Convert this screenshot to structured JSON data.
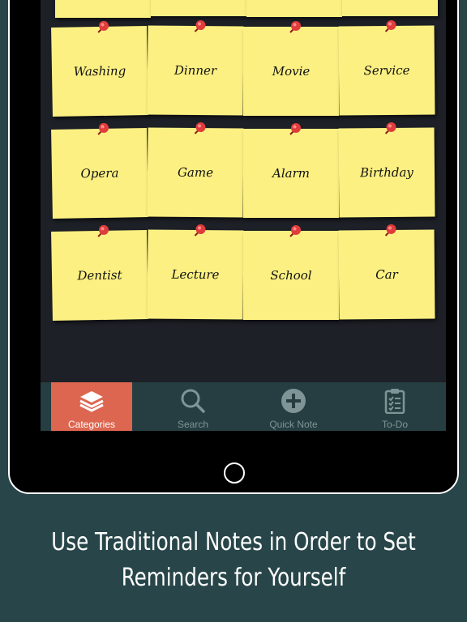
{
  "notes": [
    {
      "label": ""
    },
    {
      "label": ""
    },
    {
      "label": ""
    },
    {
      "label": ""
    },
    {
      "label": "Washing"
    },
    {
      "label": "Dinner"
    },
    {
      "label": "Movie"
    },
    {
      "label": "Service"
    },
    {
      "label": "Opera"
    },
    {
      "label": "Game"
    },
    {
      "label": "Alarm"
    },
    {
      "label": "Birthday"
    },
    {
      "label": "Dentist"
    },
    {
      "label": "Lecture"
    },
    {
      "label": "School"
    },
    {
      "label": "Car"
    }
  ],
  "tabs": [
    {
      "label": "Categories",
      "icon": "layers-icon",
      "active": true
    },
    {
      "label": "Search",
      "icon": "search-icon",
      "active": false
    },
    {
      "label": "Quick Note",
      "icon": "plus-circle-icon",
      "active": false
    },
    {
      "label": "To-Do",
      "icon": "clipboard-checklist-icon",
      "active": false
    }
  ],
  "caption": {
    "line1": "Use Traditional Notes in Order to Set",
    "line2": "Reminders for Yourself"
  },
  "colors": {
    "background": "#284649",
    "note": "#fcf082",
    "pin": "#e03c3c",
    "active_tab": "#dd6650",
    "tabbar": "#263e41"
  }
}
